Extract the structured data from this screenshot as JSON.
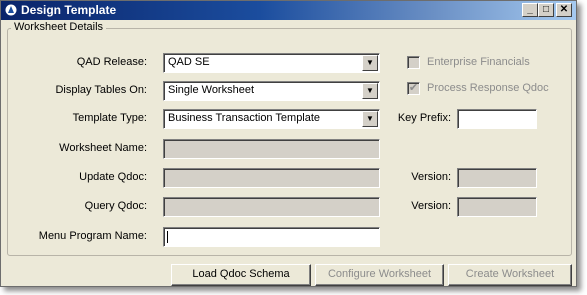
{
  "window": {
    "title": "Design Template",
    "minimize_glyph": "_",
    "maximize_glyph": "□",
    "close_glyph": "✕"
  },
  "group": {
    "label": "Worksheet Details"
  },
  "form": {
    "qad_release": {
      "label": "QAD Release:",
      "value": "QAD SE"
    },
    "display_tables_on": {
      "label": "Display Tables On:",
      "value": "Single Worksheet"
    },
    "template_type": {
      "label": "Template Type:",
      "value": "Business Transaction Template"
    },
    "worksheet_name": {
      "label": "Worksheet Name:",
      "value": ""
    },
    "update_qdoc": {
      "label": "Update Qdoc:",
      "value": ""
    },
    "query_qdoc": {
      "label": "Query Qdoc:",
      "value": ""
    },
    "menu_program_name": {
      "label": "Menu Program Name:",
      "value": ""
    },
    "key_prefix": {
      "label": "Key Prefix:",
      "value": ""
    },
    "update_version": {
      "label": "Version:",
      "value": ""
    },
    "query_version": {
      "label": "Version:",
      "value": ""
    },
    "enterprise_financials": {
      "label": "Enterprise Financials",
      "checked": false,
      "enabled": false
    },
    "process_response_qdoc": {
      "label": "Process Response Qdoc",
      "checked": true,
      "enabled": false
    },
    "dropdown_arrow_glyph": "▼",
    "checkbox_check_glyph": "✔"
  },
  "buttons": {
    "load_qdoc_schema": "Load Qdoc Schema",
    "configure_worksheet": "Configure Worksheet",
    "create_worksheet": "Create Worksheet"
  }
}
